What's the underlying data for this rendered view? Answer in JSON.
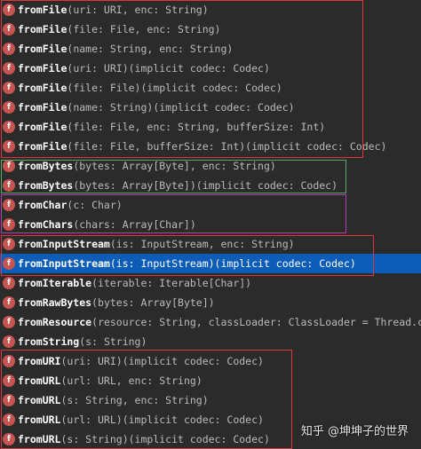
{
  "icon_glyph": "f",
  "items": [
    {
      "name": "fromFile",
      "params": "(uri: URI, enc: String)"
    },
    {
      "name": "fromFile",
      "params": "(file: File, enc: String)"
    },
    {
      "name": "fromFile",
      "params": "(name: String, enc: String)"
    },
    {
      "name": "fromFile",
      "params": "(uri: URI)(implicit codec: Codec)"
    },
    {
      "name": "fromFile",
      "params": "(file: File)(implicit codec: Codec)"
    },
    {
      "name": "fromFile",
      "params": "(name: String)(implicit codec: Codec)"
    },
    {
      "name": "fromFile",
      "params": "(file: File, enc: String, bufferSize: Int)"
    },
    {
      "name": "fromFile",
      "params": "(file: File, bufferSize: Int)(implicit codec: Codec)"
    },
    {
      "name": "fromBytes",
      "params": "(bytes: Array[Byte], enc: String)"
    },
    {
      "name": "fromBytes",
      "params": "(bytes: Array[Byte])(implicit codec: Codec)"
    },
    {
      "name": "fromChar",
      "params": "(c: Char)"
    },
    {
      "name": "fromChars",
      "params": "(chars: Array[Char])"
    },
    {
      "name": "fromInputStream",
      "params": "(is: InputStream, enc: String)"
    },
    {
      "name": "fromInputStream",
      "params": "(is: InputStream)(implicit codec: Codec)",
      "selected": true
    },
    {
      "name": "fromIterable",
      "params": "(iterable: Iterable[Char])"
    },
    {
      "name": "fromRawBytes",
      "params": "(bytes: Array[Byte])"
    },
    {
      "name": "fromResource",
      "params": "(resource: String, classLoader: ClassLoader = Thread.curren"
    },
    {
      "name": "fromString",
      "params": "(s: String)"
    },
    {
      "name": "fromURI",
      "params": "(uri: URI)(implicit codec: Codec)"
    },
    {
      "name": "fromURL",
      "params": "(url: URL, enc: String)"
    },
    {
      "name": "fromURL",
      "params": "(s: String, enc: String)"
    },
    {
      "name": "fromURL",
      "params": "(url: URL)(implicit codec: Codec)"
    },
    {
      "name": "fromURL",
      "params": "(s: String)(implicit codec: Codec)"
    }
  ],
  "highlight_colors": {
    "red": "#d9363e",
    "green": "#59a869",
    "magenta": "#b33fb3",
    "selection": "#0d5db8"
  },
  "watermark": "知乎 @坤坤子的世界"
}
